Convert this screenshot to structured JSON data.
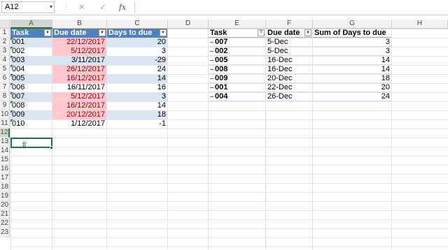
{
  "formula_bar": {
    "name_box": "A12",
    "name_box_dropdown": "▾",
    "separator": "⋮",
    "cancel_icon": "✕",
    "enter_icon": "✓",
    "fx_label": "fx",
    "formula": ""
  },
  "columns": [
    "A",
    "B",
    "C",
    "D",
    "E",
    "F",
    "G",
    "H"
  ],
  "rows": [
    "1",
    "2",
    "3",
    "4",
    "5",
    "6",
    "7",
    "8",
    "9",
    "10",
    "11",
    "12",
    "13",
    "14",
    "15",
    "16",
    "17",
    "18",
    "19",
    "20",
    "21",
    "22",
    "23"
  ],
  "table": {
    "headers": [
      "Task",
      "Due date",
      "Days to due"
    ],
    "rows": [
      {
        "task": "001",
        "due": "22/12/2017",
        "days": "20"
      },
      {
        "task": "002",
        "due": "5/12/2017",
        "days": "3"
      },
      {
        "task": "003",
        "due": "3/11/2017",
        "days": "-29"
      },
      {
        "task": "004",
        "due": "26/12/2017",
        "days": "24"
      },
      {
        "task": "005",
        "due": "16/12/2017",
        "days": "14"
      },
      {
        "task": "006",
        "due": "16/11/2017",
        "days": "16"
      },
      {
        "task": "007",
        "due": "5/12/2017",
        "days": "3"
      },
      {
        "task": "008",
        "due": "16/12/2017",
        "days": "14"
      },
      {
        "task": "009",
        "due": "20/12/2017",
        "days": "18"
      },
      {
        "task": "010",
        "due": "1/12/2017",
        "days": "-1"
      }
    ]
  },
  "pivot": {
    "headers": [
      "Task",
      "Due date",
      "Sum of Days to due"
    ],
    "rows": [
      {
        "task": "007",
        "due": "5-Dec",
        "sum": "3"
      },
      {
        "task": "002",
        "due": "5-Dec",
        "sum": "3"
      },
      {
        "task": "005",
        "due": "16-Dec",
        "sum": "14"
      },
      {
        "task": "008",
        "due": "16-Dec",
        "sum": "14"
      },
      {
        "task": "009",
        "due": "20-Dec",
        "sum": "18"
      },
      {
        "task": "001",
        "due": "22-Dec",
        "sum": "20"
      },
      {
        "task": "004",
        "due": "26-Dec",
        "sum": "24"
      }
    ]
  },
  "colors": {
    "table_header": "#4f81bd",
    "band": "#dbe4f1",
    "highlight_fill": "#ffc7ce",
    "highlight_text": "#9c0006",
    "selection": "#217346"
  }
}
